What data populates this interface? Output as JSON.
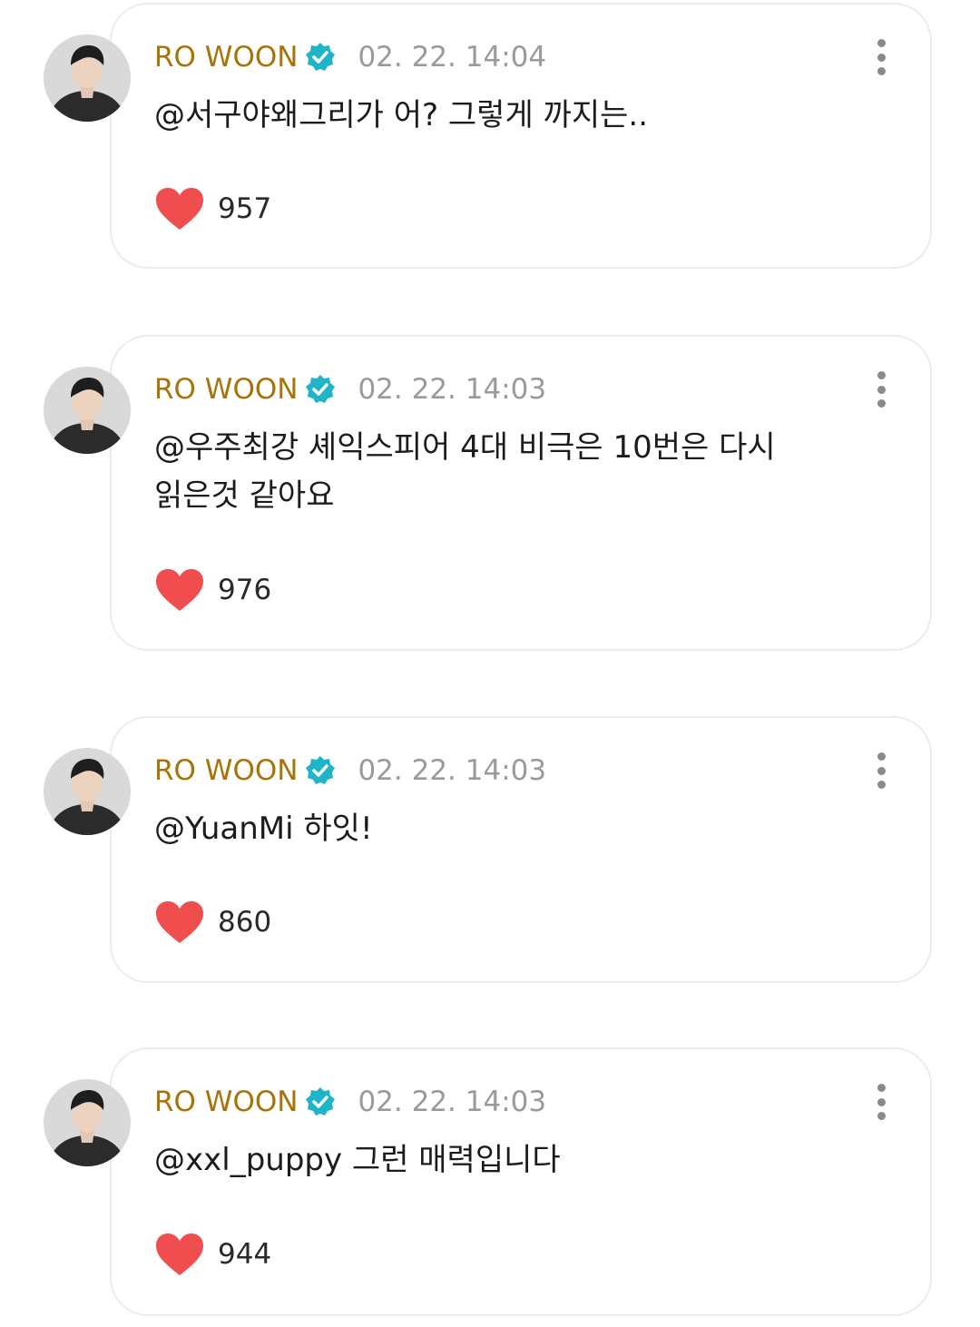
{
  "colors": {
    "author": "#a8740a",
    "timestamp": "#9a9a9a",
    "verified_badge": "#1fb4c8",
    "heart": "#f04e4e",
    "bubble_border": "#ececec"
  },
  "icons": {
    "verified": "verified-badge-icon",
    "more": "more-vertical-icon",
    "like": "heart-icon",
    "avatar": "profile-photo"
  },
  "comments": [
    {
      "author": "RO WOON",
      "timestamp": "02. 22. 14:04",
      "text": "@서구야왜그리가 어? 그렇게 까지는..",
      "likes": "957"
    },
    {
      "author": "RO WOON",
      "timestamp": "02. 22. 14:03",
      "text": "@우주최강 셰익스피어 4대 비극은 10번은 다시\n읽은것 같아요",
      "likes": "976"
    },
    {
      "author": "RO WOON",
      "timestamp": "02. 22. 14:03",
      "text": "@YuanMi 하잇!",
      "likes": "860"
    },
    {
      "author": "RO WOON",
      "timestamp": "02. 22. 14:03",
      "text": "@xxl_puppy 그런 매력입니다",
      "likes": "944"
    }
  ]
}
